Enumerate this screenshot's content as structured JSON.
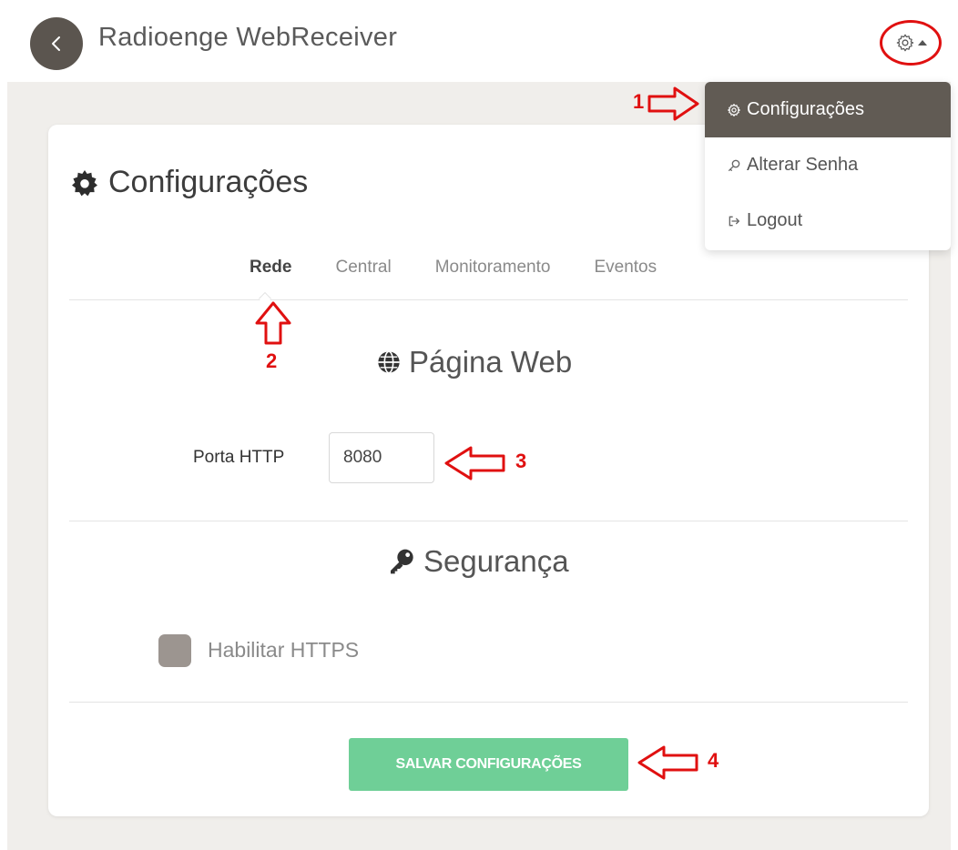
{
  "header": {
    "back_icon": "chevron-left-icon",
    "title": "Radioenge WebReceiver",
    "settings_icon": "gear-icon"
  },
  "dropdown": {
    "items": [
      {
        "label": "Configurações",
        "icon": "gear-icon",
        "active": true
      },
      {
        "label": "Alterar Senha",
        "icon": "key-icon",
        "active": false
      },
      {
        "label": "Logout",
        "icon": "logout-icon",
        "active": false
      }
    ]
  },
  "card": {
    "title": "Configurações",
    "tabs": [
      {
        "label": "Rede",
        "active": true
      },
      {
        "label": "Central",
        "active": false
      },
      {
        "label": "Monitoramento",
        "active": false
      },
      {
        "label": "Eventos",
        "active": false
      }
    ],
    "web_section": {
      "title": "Página Web",
      "icon": "globe-icon",
      "port_label": "Porta HTTP",
      "port_value": "8080"
    },
    "security_section": {
      "title": "Segurança",
      "icon": "key-icon",
      "https_label": "Habilitar HTTPS",
      "https_checked": false
    },
    "save_label": "SALVAR CONFIGURAÇÕES"
  },
  "annotations": [
    "1",
    "2",
    "3",
    "4"
  ],
  "colors": {
    "annotation": "#e01010",
    "dark_accent": "#615b54",
    "save_button": "#6fcf97",
    "page_background": "#f0eeeb"
  }
}
